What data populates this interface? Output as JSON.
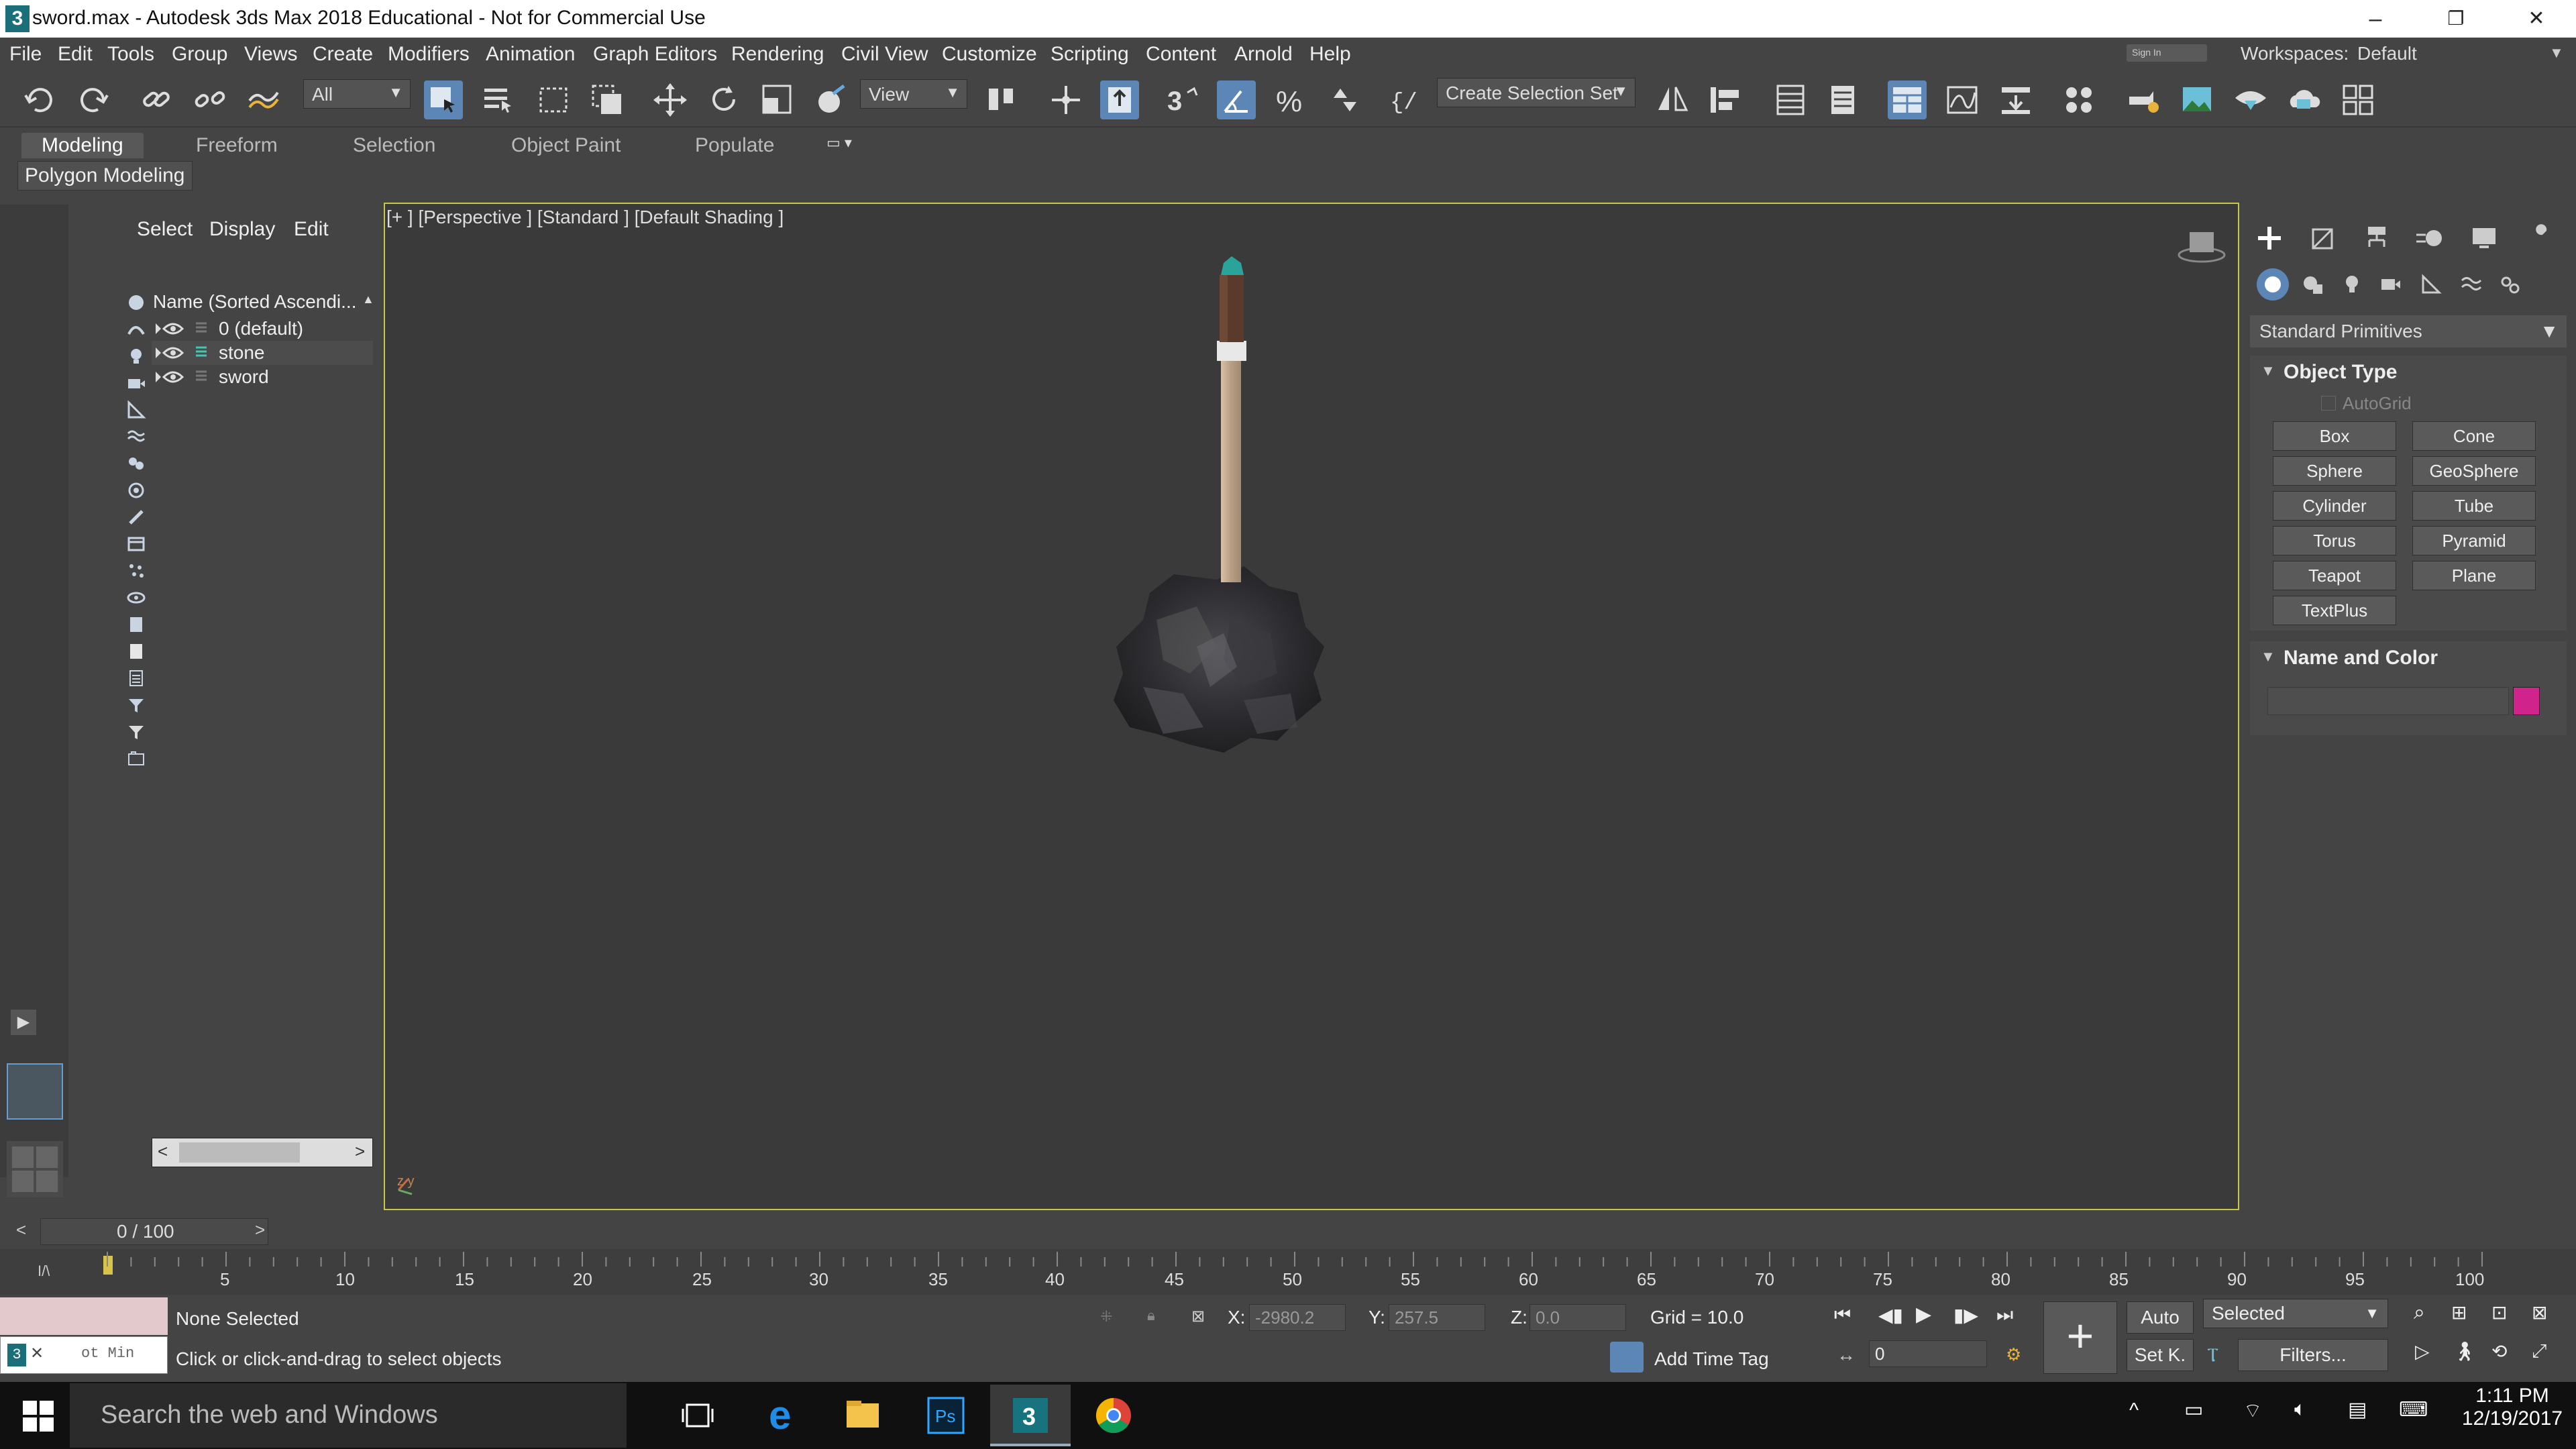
{
  "window": {
    "title": "sword.max - Autodesk 3ds Max 2018 Educational - Not for Commercial Use",
    "app_icon_text": "3",
    "controls": [
      "–",
      "❐",
      "✕"
    ]
  },
  "menu": [
    "File",
    "Edit",
    "Tools",
    "Group",
    "Views",
    "Create",
    "Modifiers",
    "Animation",
    "Graph Editors",
    "Rendering",
    "Civil View",
    "Customize",
    "Scripting",
    "Content",
    "Arnold",
    "Help"
  ],
  "workspace": {
    "signin": "Sign In",
    "label": "Workspaces:",
    "value": "Default"
  },
  "toolbar": {
    "filter_value": "All",
    "ref_coord_value": "View",
    "selection_set_value": "Create Selection Set",
    "snap_label": "3",
    "percent_label": "%"
  },
  "ribbon": {
    "tabs": [
      "Modeling",
      "Freeform",
      "Selection",
      "Object Paint",
      "Populate"
    ],
    "active_tab": "Modeling",
    "panel_label": "Polygon Modeling"
  },
  "explorer": {
    "menu": [
      "Select",
      "Display",
      "Edit"
    ],
    "column_header": "Name (Sorted Ascendi...",
    "rows": [
      {
        "name": "0 (default)"
      },
      {
        "name": "stone"
      },
      {
        "name": "sword"
      }
    ]
  },
  "viewport": {
    "label": "[+ ] [Perspective ] [Standard ] [Default Shading ]",
    "axis_label": "z y"
  },
  "command_panel": {
    "category_dropdown": "Standard Primitives",
    "object_type_title": "Object Type",
    "autogrid": "AutoGrid",
    "primitives": [
      "Box",
      "Cone",
      "Sphere",
      "GeoSphere",
      "Cylinder",
      "Tube",
      "Torus",
      "Pyramid",
      "Teapot",
      "Plane",
      "TextPlus"
    ],
    "name_color_title": "Name and Color",
    "swatch_color": "#d1238c"
  },
  "timeline": {
    "slider_label": "0 / 100",
    "ticks": [
      "5",
      "10",
      "15",
      "20",
      "25",
      "30",
      "35",
      "40",
      "45",
      "50",
      "55",
      "60",
      "65",
      "70",
      "75",
      "80",
      "85",
      "90",
      "95",
      "100"
    ]
  },
  "status": {
    "selection": "None Selected",
    "prompt": "Click or click-and-drag to select objects",
    "maxscript_text": "ot Min",
    "x_label": "X:",
    "x_value": "-2980.2",
    "y_label": "Y:",
    "y_value": "257.5",
    "z_label": "Z:",
    "z_value": "0.0",
    "grid": "Grid = 10.0",
    "add_time_tag": "Add Time Tag",
    "auto_key": "Auto",
    "set_key": "Set K.",
    "key_filter": "Selected",
    "filters": "Filters...",
    "frame_value": "0"
  },
  "taskbar": {
    "search_placeholder": "Search the web and Windows",
    "time": "1:11 PM",
    "date": "12/19/2017"
  }
}
